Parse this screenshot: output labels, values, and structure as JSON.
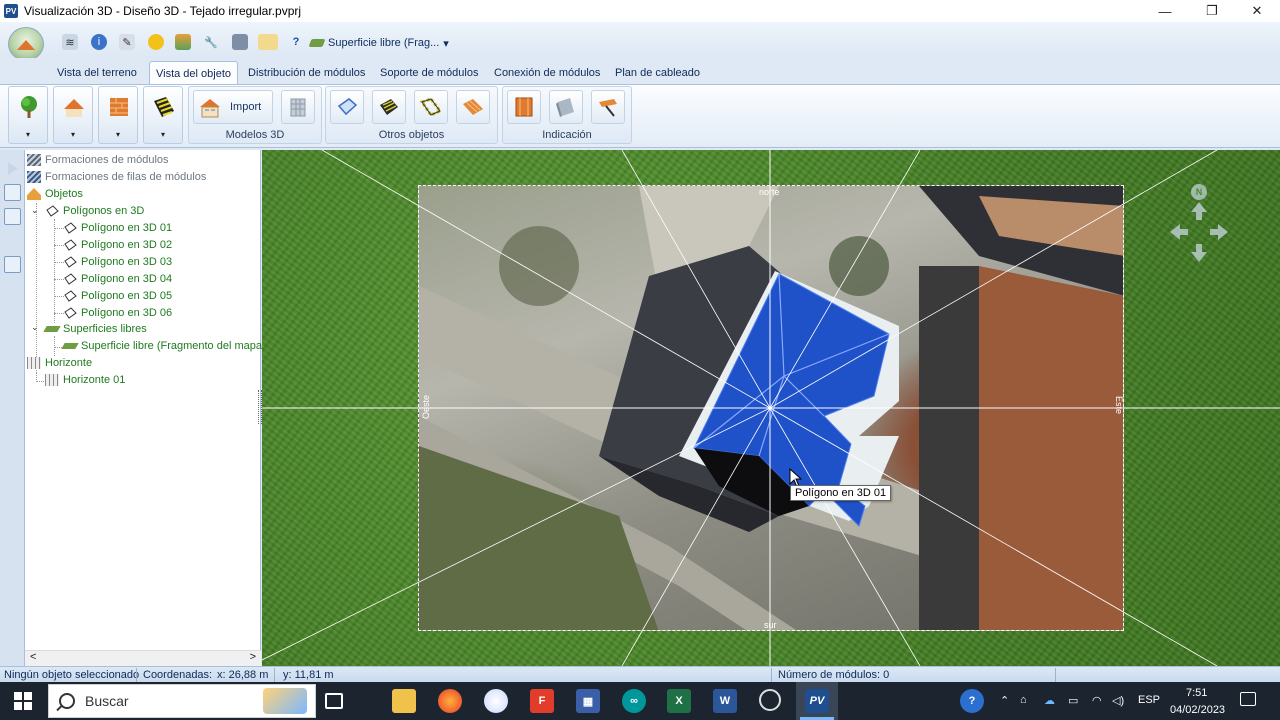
{
  "window": {
    "title": "Visualización 3D - Diseño 3D - Tejado irregular.pvprj",
    "app_icon": "PV",
    "controls": [
      "minimize",
      "restore",
      "close"
    ]
  },
  "quick_access": {
    "icons": [
      "layers-icon",
      "info-icon",
      "tool-icon",
      "sun-icon",
      "image-icon",
      "wrench-icon",
      "camera-icon",
      "roof-tile-icon",
      "help-icon"
    ],
    "help_label": "?",
    "combo_value": "Superficie libre (Frag...",
    "combo_arrow": "▾"
  },
  "tabs": [
    {
      "label": "Vista del terreno",
      "active": false
    },
    {
      "label": "Vista del objeto",
      "active": true
    },
    {
      "label": "Distribución de módulos",
      "active": false
    },
    {
      "label": "Soporte de módulos",
      "active": false
    },
    {
      "label": "Conexión de módulos",
      "active": false
    },
    {
      "label": "Plan de cableado",
      "active": false
    }
  ],
  "ribbon": {
    "large_buttons": [
      "tree-icon",
      "roof-icon",
      "brick-wall-icon",
      "striped-surface-icon"
    ],
    "dropdown_arrow": "▾",
    "groups": {
      "models3d": {
        "label": "Modelos 3D",
        "import_label": "Import"
      },
      "other_objects": {
        "label": "Otros objetos"
      },
      "indication": {
        "label": "Indicación"
      }
    }
  },
  "tree": {
    "items": [
      {
        "label": "Formaciones de módulos",
        "style": "gray"
      },
      {
        "label": "Formaciones de filas de módulos",
        "style": "gray"
      },
      {
        "label": "Objetos",
        "style": "green"
      },
      {
        "label": "Polígonos en 3D",
        "style": "green"
      },
      {
        "label": "Polígono en 3D 01",
        "style": "green"
      },
      {
        "label": "Polígono en 3D 02",
        "style": "green"
      },
      {
        "label": "Polígono en 3D 03",
        "style": "green"
      },
      {
        "label": "Polígono en 3D 04",
        "style": "green"
      },
      {
        "label": "Polígono en 3D 05",
        "style": "green"
      },
      {
        "label": "Polígono en 3D 06",
        "style": "green"
      },
      {
        "label": "Superficies libres",
        "style": "green"
      },
      {
        "label": "Superficie libre (Fragmento del mapa)",
        "style": "green"
      },
      {
        "label": "Horizonte",
        "style": "green"
      },
      {
        "label": "Horizonte 01",
        "style": "green"
      }
    ],
    "expander": "⌄",
    "scroll_left": "<",
    "scroll_right": ">"
  },
  "viewport": {
    "directions": {
      "north": "norte",
      "south": "sur",
      "east": "Este",
      "west": "Oeste"
    },
    "compass_n": "N",
    "tooltip": "Polígono en 3D 01",
    "colors": {
      "roof": "#1f52c8",
      "roof_edge": "#88a8ff",
      "grass": "#4f8a2e"
    }
  },
  "status": {
    "selection": "Ningún objeto seleccionado",
    "coords_label": "Coordenadas:",
    "x": "x: 26,88 m",
    "y": "y: 11,81 m",
    "modules": "Número de módulos:  0"
  },
  "taskbar": {
    "search_placeholder": "Buscar",
    "apps": [
      "task-view-icon",
      "file-explorer-icon",
      "firefox-icon",
      "paint-icon",
      "foxit-icon",
      "calculator-icon",
      "arduino-icon",
      "excel-icon",
      "word-icon",
      "clock-app-icon",
      "pv-sol-icon"
    ],
    "language": "ESP",
    "time": "7:51",
    "date": "04/02/2023"
  }
}
